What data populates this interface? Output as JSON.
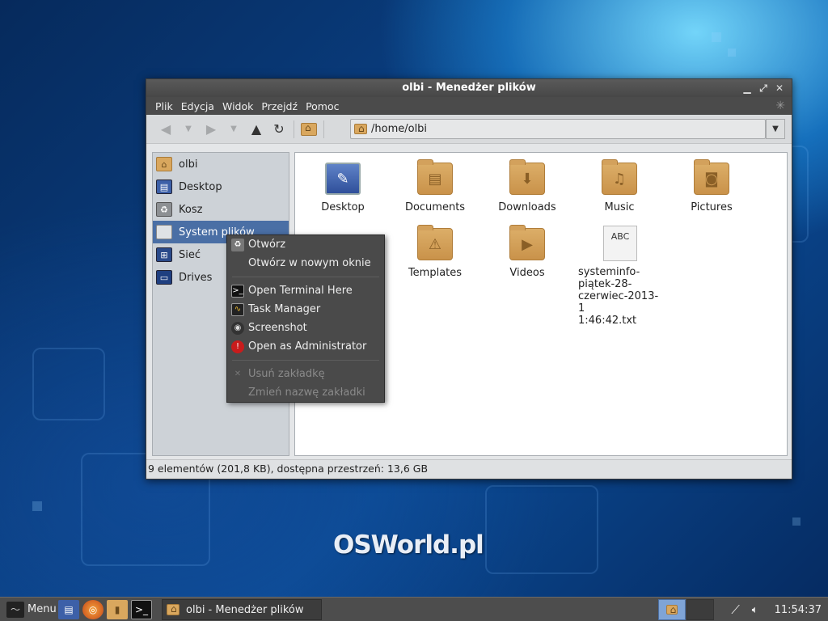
{
  "window": {
    "title": "olbi - Menedżer plików",
    "menu": [
      "Plik",
      "Edycja",
      "Widok",
      "Przejdź",
      "Pomoc"
    ],
    "path": "/home/olbi",
    "status": "9 elementów (201,8 KB), dostępna przestrzeń: 13,6 GB"
  },
  "sidebar": {
    "items": [
      {
        "label": "olbi",
        "icon": "home-folder-icon"
      },
      {
        "label": "Desktop",
        "icon": "desktop-icon"
      },
      {
        "label": "Kosz",
        "icon": "trash-icon"
      },
      {
        "label": "System plików",
        "icon": "drive-icon"
      },
      {
        "label": "Sieć",
        "icon": "network-icon"
      },
      {
        "label": "Drives",
        "icon": "monitor-icon"
      }
    ],
    "selected": "System plików"
  },
  "files": [
    {
      "name": "Desktop",
      "icon": "desktop-icon"
    },
    {
      "name": "Documents",
      "icon": "documents-folder-icon"
    },
    {
      "name": "Downloads",
      "icon": "downloads-folder-icon"
    },
    {
      "name": "Music",
      "icon": "music-folder-icon"
    },
    {
      "name": "Pictures",
      "icon": "pictures-folder-icon"
    },
    {
      "name": "Templates",
      "icon": "templates-folder-icon"
    },
    {
      "name": "Videos",
      "icon": "videos-folder-icon"
    },
    {
      "name": "systeminfo-piątek-28-czerwiec-2013-11:46:42.txt",
      "icon": "text-file-icon",
      "lines": [
        "systeminfo-",
        "piątek-28-",
        "czerwiec-2013-1",
        "1:46:42.txt"
      ]
    }
  ],
  "context_menu": {
    "items": [
      {
        "label": "Otwórz",
        "icon": "trash-small-icon",
        "enabled": true
      },
      {
        "label": "Otwórz w nowym oknie",
        "icon": "",
        "enabled": true
      },
      {
        "label": "Open Terminal Here",
        "icon": "terminal-icon",
        "enabled": true
      },
      {
        "label": "Task Manager",
        "icon": "task-manager-icon",
        "enabled": true
      },
      {
        "label": "Screenshot",
        "icon": "screenshot-icon",
        "enabled": true
      },
      {
        "label": "Open as Administrator",
        "icon": "admin-warning-icon",
        "enabled": true
      },
      {
        "label": "Usuń zakładkę",
        "icon": "remove-icon",
        "enabled": false
      },
      {
        "label": "Zmień nazwę zakładki",
        "icon": "",
        "enabled": false
      }
    ]
  },
  "watermark": "OSWorld.pl",
  "taskbar": {
    "menu_label": "Menu",
    "task_label": "olbi - Menedżer plików",
    "clock": "11:54:37"
  },
  "colors": {
    "selection": "#4a6fa5",
    "folder": "#d9a75e",
    "titlebar": "#4b4b4b",
    "context_menu_bg": "#4a4a4a"
  }
}
